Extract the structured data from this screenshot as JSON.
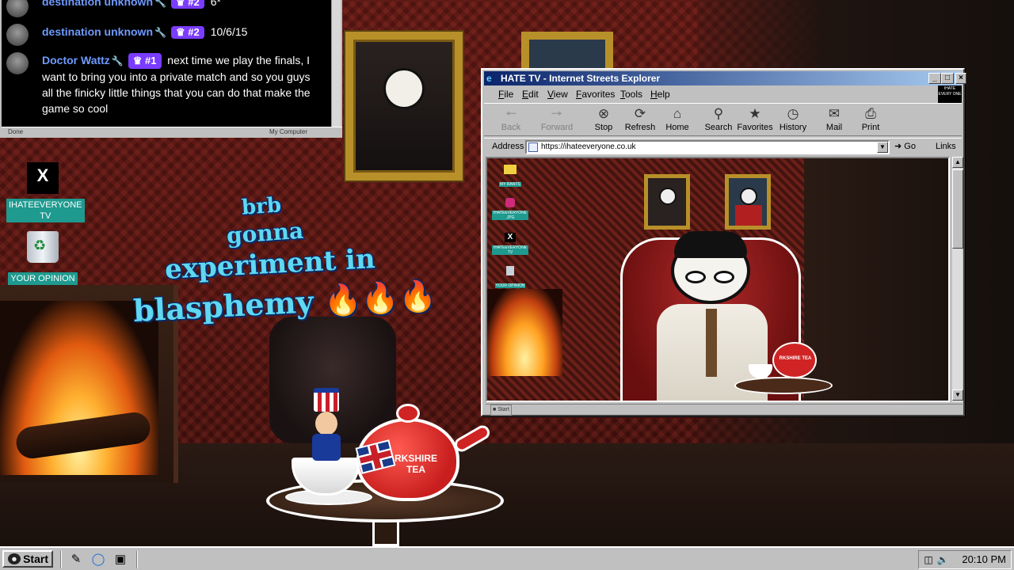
{
  "chat": {
    "messages": [
      {
        "user": "destination unknown",
        "rank": "#2",
        "text": "6*"
      },
      {
        "user": "destination unknown",
        "rank": "#2",
        "text": "10/6/15"
      },
      {
        "user": "Doctor Wattz",
        "rank": "#1",
        "text": "next time we play the finals, I want to bring you into a private match and so you guys all the finicky little things that you can do that make the game so cool"
      }
    ],
    "status_left": "Done",
    "status_zone": "My Computer"
  },
  "desktop_icons": [
    {
      "label": "IHATEEVERYONE TV",
      "icon": "x-logo-icon"
    },
    {
      "label": "YOUR OPINION",
      "icon": "recycle-bin-icon"
    }
  ],
  "overlay_text": {
    "line1": "brb",
    "line2": "gonna",
    "line3": "experiment in",
    "line4": "blasphemy 🔥🔥🔥"
  },
  "sticker": {
    "tea_brand_top": "RKSHIRE",
    "tea_brand_bottom": "TEA"
  },
  "browser": {
    "title": "HATE TV - Internet Streets Explorer",
    "menu": [
      "File",
      "Edit",
      "View",
      "Favorites",
      "Tools",
      "Help"
    ],
    "brand_badge": "IHATE EVERY ONE",
    "toolbar": [
      {
        "label": "Back",
        "icon": "back-arrow-icon",
        "enabled": false
      },
      {
        "label": "Forward",
        "icon": "forward-arrow-icon",
        "enabled": false
      },
      {
        "label": "Stop",
        "icon": "stop-icon",
        "enabled": true
      },
      {
        "label": "Refresh",
        "icon": "refresh-icon",
        "enabled": true
      },
      {
        "label": "Home",
        "icon": "home-icon",
        "enabled": true
      },
      {
        "label": "Search",
        "icon": "search-icon",
        "enabled": true
      },
      {
        "label": "Favorites",
        "icon": "favorites-icon",
        "enabled": true
      },
      {
        "label": "History",
        "icon": "history-icon",
        "enabled": true
      },
      {
        "label": "Mail",
        "icon": "mail-icon",
        "enabled": true
      },
      {
        "label": "Print",
        "icon": "print-icon",
        "enabled": true
      }
    ],
    "address_label": "Address",
    "url": "https://ihateeveryone.co.uk",
    "go_label": "Go",
    "links_label": "Links",
    "inner_icons": [
      {
        "label": "MY RANTS",
        "icon": "folder-icon"
      },
      {
        "label": "IHATEEVERYONE .JPG",
        "icon": "instagram-icon"
      },
      {
        "label": "IHATEEVERYONE TV",
        "icon": "x-logo-icon"
      },
      {
        "label": "YOUR OPINION",
        "icon": "recycle-bin-icon"
      }
    ],
    "inner_tea_label": "RKSHIRE TEA",
    "inner_start": "Start"
  },
  "taskbar": {
    "start_label": "Start",
    "clock": "20:10 PM"
  },
  "colors": {
    "desktop_label_bg": "#1e9a8f",
    "title_gradient_start": "#0a246a",
    "rank_badge": "#7a3cff",
    "overlay_text": "#5fd8f0"
  }
}
